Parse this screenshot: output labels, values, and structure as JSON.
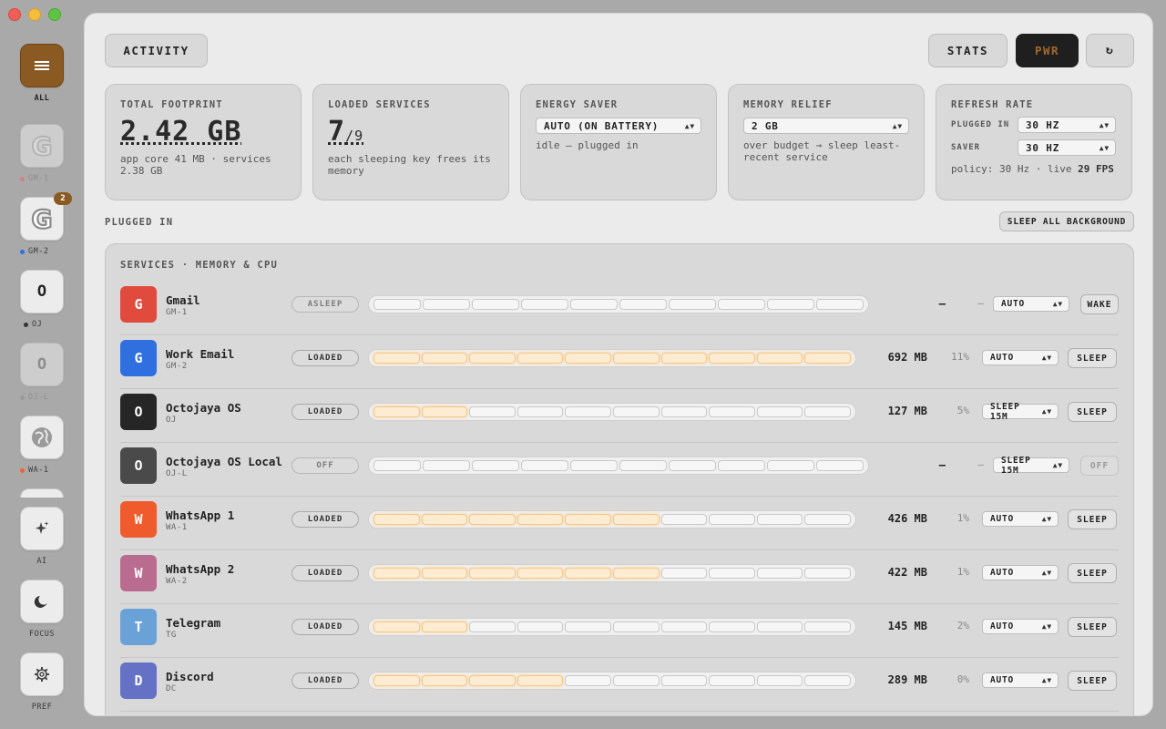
{
  "sidebar": {
    "all_label": "ALL",
    "items": [
      {
        "label": "GM-1",
        "dot": "#e66b63",
        "faded": true
      },
      {
        "label": "GM-2",
        "dot": "#2f6fe0",
        "badge": "2"
      },
      {
        "label": "OJ",
        "dot": "#333333",
        "letter": "O"
      },
      {
        "label": "OJ-L",
        "dot": "#999999",
        "letter": "O",
        "faded": true
      },
      {
        "label": "WA-1",
        "dot": "#ef6234"
      }
    ],
    "ai_label": "AI",
    "focus_label": "FOCUS",
    "pref_label": "PREF"
  },
  "header": {
    "activity": "ACTIVITY",
    "stats": "STATS",
    "pwr": "PWR",
    "refresh": "↻"
  },
  "cards": {
    "footprint": {
      "title": "TOTAL FOOTPRINT",
      "value": "2.42 GB",
      "sub": "app core 41 MB · services 2.38 GB"
    },
    "loaded": {
      "title": "LOADED SERVICES",
      "value": "7",
      "total": "/9",
      "sub": "each sleeping key frees its memory"
    },
    "energy": {
      "title": "ENERGY SAVER",
      "select": "AUTO (ON BATTERY)",
      "sub": "idle — plugged in"
    },
    "memory": {
      "title": "MEMORY RELIEF",
      "select": "2 GB",
      "sub": "over budget → sleep least-recent service"
    },
    "refresh": {
      "title": "REFRESH RATE",
      "plugged_label": "PLUGGED IN",
      "plugged_value": "30 HZ",
      "saver_label": "SAVER",
      "saver_value": "30 HZ",
      "policy": "policy: 30 Hz · live ",
      "fps": "29 FPS"
    }
  },
  "section": {
    "label": "PLUGGED IN",
    "sleep_all": "SLEEP ALL BACKGROUND",
    "services_title": "SERVICES · MEMORY & CPU"
  },
  "colors": {
    "accent": "#8b5a22",
    "pwr_text": "#a0692c"
  },
  "services": [
    {
      "initial": "G",
      "name": "Gmail",
      "code": "GM-1",
      "state": "ASLEEP",
      "mem": "—",
      "cpu": "—",
      "mode": "AUTO",
      "action": "WAKE",
      "level": 0,
      "color": "#e04b3e",
      "muted": true
    },
    {
      "initial": "G",
      "name": "Work Email",
      "code": "GM-2",
      "state": "LOADED",
      "mem": "692 MB",
      "cpu": "11%",
      "mode": "AUTO",
      "action": "SLEEP",
      "level": 10,
      "color": "#2f6fe0"
    },
    {
      "initial": "O",
      "name": "Octojaya OS",
      "code": "OJ",
      "state": "LOADED",
      "mem": "127 MB",
      "cpu": "5%",
      "mode": "SLEEP 15M",
      "action": "SLEEP",
      "level": 2,
      "color": "#262626"
    },
    {
      "initial": "O",
      "name": "Octojaya OS Local",
      "code": "OJ-L",
      "state": "OFF",
      "mem": "—",
      "cpu": "—",
      "mode": "SLEEP 15M",
      "action": "OFF",
      "level": 0,
      "color": "#4a4a4a",
      "muted": true
    },
    {
      "initial": "W",
      "name": "WhatsApp 1",
      "code": "WA-1",
      "state": "LOADED",
      "mem": "426 MB",
      "cpu": "1%",
      "mode": "AUTO",
      "action": "SLEEP",
      "level": 6,
      "color": "#ef5b2c"
    },
    {
      "initial": "W",
      "name": "WhatsApp 2",
      "code": "WA-2",
      "state": "LOADED",
      "mem": "422 MB",
      "cpu": "1%",
      "mode": "AUTO",
      "action": "SLEEP",
      "level": 6,
      "color": "#b96c8f"
    },
    {
      "initial": "T",
      "name": "Telegram",
      "code": "TG",
      "state": "LOADED",
      "mem": "145 MB",
      "cpu": "2%",
      "mode": "AUTO",
      "action": "SLEEP",
      "level": 2,
      "color": "#6aa2d8"
    },
    {
      "initial": "D",
      "name": "Discord",
      "code": "DC",
      "state": "LOADED",
      "mem": "289 MB",
      "cpu": "0%",
      "mode": "AUTO",
      "action": "SLEEP",
      "level": 4,
      "color": "#6571c4"
    }
  ]
}
